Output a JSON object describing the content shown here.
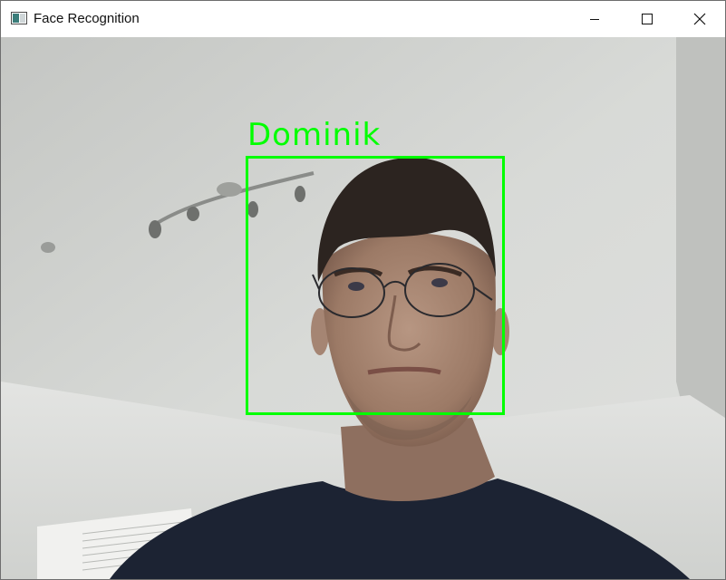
{
  "window": {
    "title": "Face Recognition",
    "app_icon": "window-app-icon",
    "controls": {
      "minimize_icon": "minimize-icon",
      "maximize_icon": "maximize-icon",
      "close_icon": "close-icon"
    }
  },
  "video": {
    "detections": [
      {
        "label": "Dominik",
        "box_color": "#00ff00"
      }
    ]
  },
  "colors": {
    "detection": "#00ff00",
    "titlebar": "#ffffff"
  }
}
